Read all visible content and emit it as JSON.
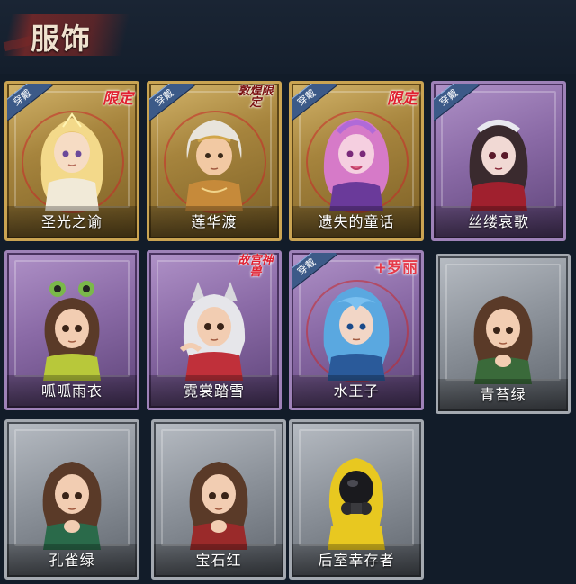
{
  "page": {
    "title": "服饰"
  },
  "colors": {
    "gold": "#caa452",
    "purple": "#9e82b8",
    "grey": "#a4a9b0",
    "equip": "#3c5a88"
  },
  "cards": [
    {
      "name": "圣光之谕",
      "rarity": "gold",
      "equipped": "穿戴",
      "tag": "限定",
      "icon": "angel-portrait-icon"
    },
    {
      "name": "莲华渡",
      "rarity": "gold",
      "equipped": "穿戴",
      "tag": "敦煌限定",
      "icon": "monk-portrait-icon"
    },
    {
      "name": "遗失的童话",
      "rarity": "gold",
      "equipped": "穿戴",
      "tag": "限定",
      "icon": "fairytale-portrait-icon"
    },
    {
      "name": "丝缕哀歌",
      "rarity": "purple",
      "equipped": "穿戴",
      "tag": "",
      "icon": "doll-portrait-icon"
    },
    {
      "name": "呱呱雨衣",
      "rarity": "purple",
      "equipped": "",
      "tag": "",
      "icon": "frog-portrait-icon"
    },
    {
      "name": "霓裳踏雪",
      "rarity": "purple",
      "equipped": "",
      "tag": "故宫神兽",
      "icon": "wolf-portrait-icon"
    },
    {
      "name": "水王子",
      "rarity": "purple",
      "equipped": "穿戴",
      "tag": "+罗丽",
      "icon": "water-prince-portrait-icon"
    },
    {
      "name": "青苔绿",
      "rarity": "grey",
      "equipped": "",
      "tag": "",
      "icon": "girl-green-portrait-icon"
    },
    {
      "name": "孔雀绿",
      "rarity": "grey",
      "equipped": "",
      "tag": "",
      "icon": "girl-green-portrait-icon"
    },
    {
      "name": "宝石红",
      "rarity": "grey",
      "equipped": "",
      "tag": "",
      "icon": "girl-red-portrait-icon"
    },
    {
      "name": "后室幸存者",
      "rarity": "grey",
      "equipped": "",
      "tag": "",
      "icon": "hazmat-portrait-icon"
    }
  ]
}
